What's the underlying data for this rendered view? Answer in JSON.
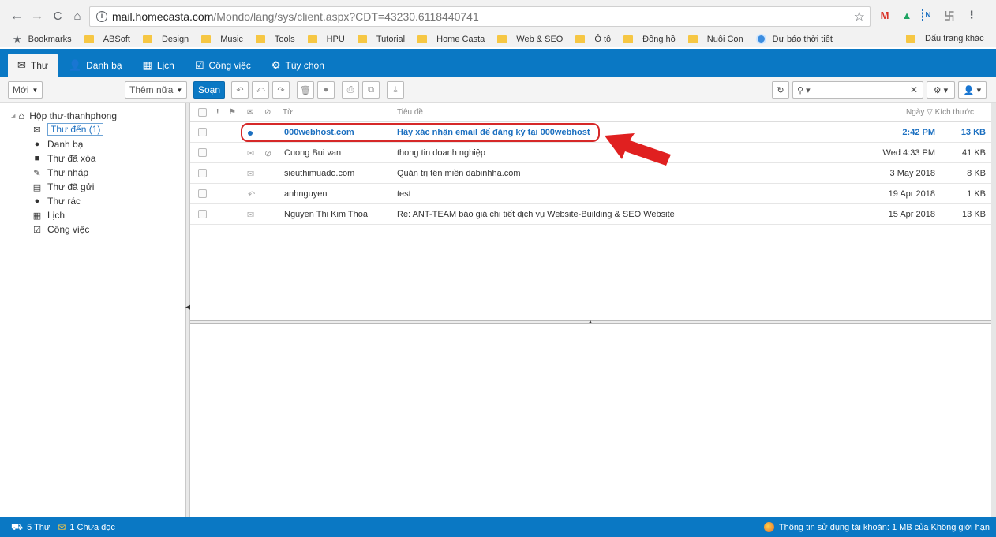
{
  "browser": {
    "back_icon": "back-arrow-icon",
    "url_host": "mail.homecasta.com",
    "url_path": "/Mondo/lang/sys/client.aspx?CDT=43230.6118440741",
    "extensions": [
      "M",
      "▲",
      "N",
      "卐",
      "⋮"
    ],
    "bookmarks_label": "Bookmarks",
    "bookmarks": [
      "ABSoft",
      "Design",
      "Music",
      "Tools",
      "HPU",
      "Tutorial",
      "Home Casta",
      "Web & SEO",
      "Ô tô",
      "Đồng hồ",
      "Nuôi Con"
    ],
    "weather_bookmark": "Dự báo thời tiết",
    "other_bookmarks": "Dấu trang khác"
  },
  "app_tabs": [
    {
      "label": "Thư",
      "icon": "envelope-icon"
    },
    {
      "label": "Danh bạ",
      "icon": "person-icon"
    },
    {
      "label": "Lịch",
      "icon": "calendar-icon"
    },
    {
      "label": "Công việc",
      "icon": "clipboard-icon"
    },
    {
      "label": "Tùy chọn",
      "icon": "gear-icon"
    }
  ],
  "toolbar": {
    "new_label": "Mới",
    "more_label": "Thêm nữa",
    "compose_label": "Soạn"
  },
  "folders": {
    "root": "Hộp thư-thanhphong",
    "items": [
      {
        "label": "Thư đến (1)",
        "icon": "inbox-icon"
      },
      {
        "label": "Danh bạ",
        "icon": "contacts-icon"
      },
      {
        "label": "Thư đã xóa",
        "icon": "trash-icon"
      },
      {
        "label": "Thư nháp",
        "icon": "draft-icon"
      },
      {
        "label": "Thư đã gửi",
        "icon": "sent-icon"
      },
      {
        "label": "Thư rác",
        "icon": "spam-icon"
      },
      {
        "label": "Lịch",
        "icon": "calendar-icon"
      },
      {
        "label": "Công việc",
        "icon": "task-icon"
      }
    ]
  },
  "list": {
    "headers": {
      "from": "Từ",
      "subject": "Tiêu đề",
      "date": "Ngày",
      "size": "Kích thước"
    },
    "messages": [
      {
        "from": "000webhost.com",
        "subject": "Hãy xác nhận email để đăng ký tại 000webhost",
        "date": "2:42 PM",
        "size": "13 KB",
        "unread": true,
        "status": "unread-dot",
        "attachment": false
      },
      {
        "from": "Cuong Bui van",
        "subject": "thong tin doanh nghiệp",
        "date": "Wed 4:33 PM",
        "size": "41 KB",
        "unread": false,
        "status": "envelope",
        "attachment": true
      },
      {
        "from": "sieuthimuado.com",
        "subject": "Quản trị tên miền dabinhha.com",
        "date": "3 May 2018",
        "size": "8 KB",
        "unread": false,
        "status": "envelope",
        "attachment": false
      },
      {
        "from": "anhnguyen",
        "subject": "test",
        "date": "19 Apr 2018",
        "size": "1 KB",
        "unread": false,
        "status": "replied",
        "attachment": false
      },
      {
        "from": "Nguyen Thi Kim Thoa",
        "subject": "Re: ANT-TEAM báo giá chi tiết dịch vụ Website-Building & SEO Website",
        "date": "15 Apr 2018",
        "size": "13 KB",
        "unread": false,
        "status": "envelope",
        "attachment": false
      }
    ]
  },
  "status": {
    "total": "5 Thư",
    "unread": "1 Chưa đọc",
    "usage": "Thông tin sử dụng tài khoản: 1 MB của Không giới hạn"
  },
  "colors": {
    "accent": "#0a78c4",
    "unread": "#1b6fc0",
    "annotation": "#e02020"
  }
}
